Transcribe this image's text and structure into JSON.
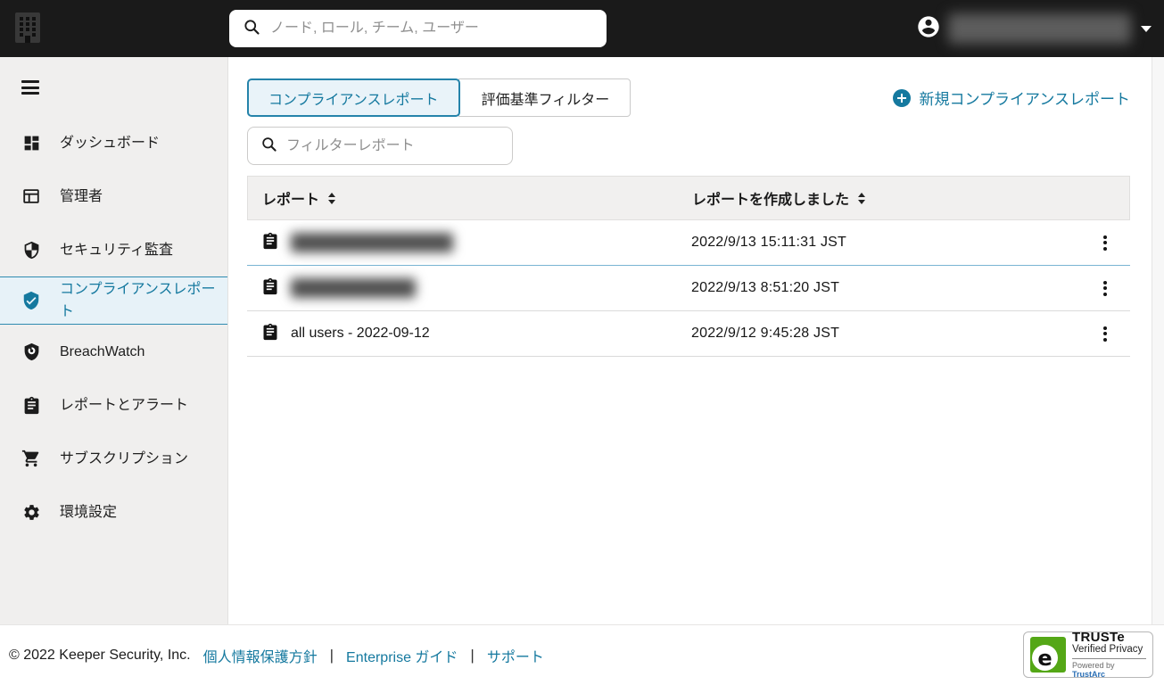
{
  "topbar": {
    "search_placeholder": "ノード, ロール, チーム, ユーザー"
  },
  "sidebar": {
    "items": [
      {
        "label": "ダッシュボード",
        "selected": false
      },
      {
        "label": "管理者",
        "selected": false
      },
      {
        "label": "セキュリティ監査",
        "selected": false
      },
      {
        "label": "コンプライアンスレポート",
        "selected": true
      },
      {
        "label": "BreachWatch",
        "selected": false
      },
      {
        "label": "レポートとアラート",
        "selected": false
      },
      {
        "label": "サブスクリプション",
        "selected": false
      },
      {
        "label": "環境設定",
        "selected": false
      }
    ]
  },
  "main": {
    "tabs": [
      {
        "label": "コンプライアンスレポート",
        "active": true
      },
      {
        "label": "評価基準フィルター",
        "active": false
      }
    ],
    "new_report_label": "新規コンプライアンスレポート",
    "filter_placeholder": "フィルターレポート",
    "table": {
      "columns": [
        {
          "label": "レポート",
          "sortable": true
        },
        {
          "label": "レポートを作成しました",
          "sortable": true
        }
      ],
      "rows": [
        {
          "name": "",
          "redacted": true,
          "created": "2022/9/13 15:11:31 JST"
        },
        {
          "name": "",
          "redacted": true,
          "created": "2022/9/13 8:51:20 JST"
        },
        {
          "name": "all users - 2022-09-12",
          "redacted": false,
          "created": "2022/9/12 9:45:28 JST"
        }
      ]
    }
  },
  "footer": {
    "copyright": "© 2022 Keeper Security, Inc.",
    "links": [
      {
        "label": "個人情報保護方針"
      },
      {
        "label": "Enterprise ガイド"
      },
      {
        "label": "サポート"
      }
    ],
    "separator": "|",
    "truste": {
      "logo_letter": "e",
      "title": "TRUSTe",
      "subtitle": "Verified Privacy",
      "powered_prefix": "Powered by ",
      "powered_brand": "TrustArc"
    }
  },
  "colors": {
    "accent_teal": "#15799f",
    "topbar_black": "#1a1a1a",
    "sidebar_gray": "#f0efee",
    "selected_item_bg": "#e7f2f8",
    "truste_green": "#54a716",
    "trustarc_blue": "#2a6fb5"
  }
}
